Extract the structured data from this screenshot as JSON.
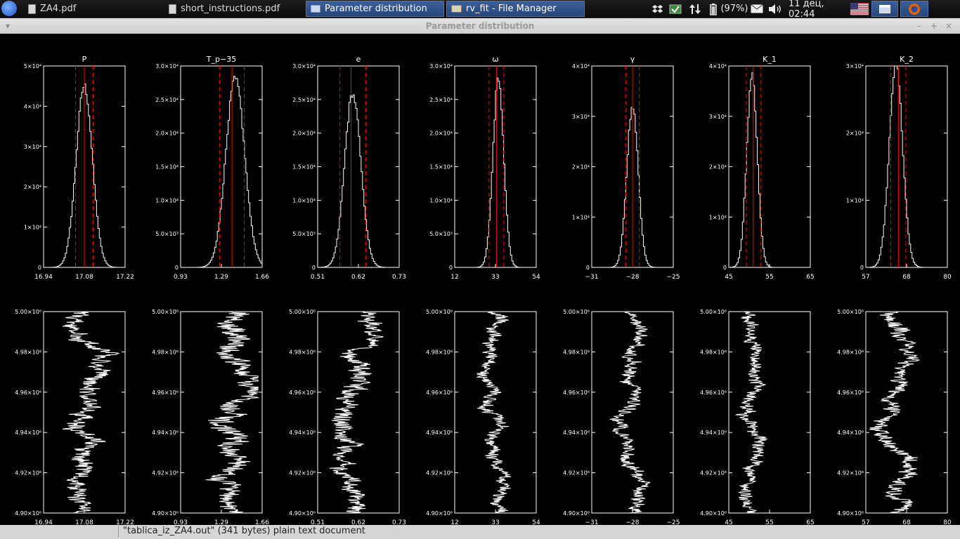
{
  "taskbar": {
    "items": [
      {
        "label": "ZA4.pdf",
        "icon": "document-icon"
      },
      {
        "label": "short_instructions.pdf",
        "icon": "document-icon"
      },
      {
        "label": "Parameter distribution",
        "icon": "window-icon"
      },
      {
        "label": "rv_fit - File Manager",
        "icon": "folder-icon"
      }
    ],
    "battery": "(97%)",
    "clock": "11 дец, 02:44"
  },
  "window": {
    "title": "Parameter distribution",
    "buttons": {
      "menu": "▾",
      "minimize": "–",
      "maximize": "+",
      "close": "×"
    }
  },
  "statusbar": {
    "text": "\"tablica_iz_ZA4.out\" (341 bytes) plain text document"
  },
  "chart_data": [
    {
      "type": "histogram",
      "title": "P",
      "xticks": [
        "16.94",
        "17.08",
        "17.22"
      ],
      "xlim": [
        16.94,
        17.22
      ],
      "yticks": [
        "0",
        "1×10⁴",
        "2×10⁴",
        "3×10⁴",
        "4×10⁴",
        "5×10⁴"
      ],
      "ylim": [
        0,
        50000
      ],
      "mean": 17.08,
      "lower": 17.05,
      "upper": 17.11,
      "peak_x": 17.08,
      "peak_y": 45000,
      "sigma": 0.028,
      "line_color": "#ff0000"
    },
    {
      "type": "histogram",
      "title": "T_p−35",
      "xticks": [
        "0.93",
        "1.29",
        "1.66"
      ],
      "xlim": [
        0.93,
        1.66
      ],
      "yticks": [
        "0",
        "5.0×10³",
        "1.0×10⁴",
        "1.5×10⁴",
        "2.0×10⁴",
        "2.5×10⁴",
        "3.0×10⁴"
      ],
      "ylim": [
        0,
        30000
      ],
      "mean": 1.39,
      "lower": 1.28,
      "upper": 1.5,
      "peak_x": 1.42,
      "peak_y": 28000,
      "sigma": 0.085,
      "line_color": "#ff0000"
    },
    {
      "type": "histogram",
      "title": "e",
      "xticks": [
        "0.51",
        "0.62",
        "0.73"
      ],
      "xlim": [
        0.51,
        0.73
      ],
      "yticks": [
        "0",
        "5.0×10³",
        "1.0×10⁴",
        "1.5×10⁴",
        "2.0×10⁴",
        "2.5×10⁴",
        "3.0×10⁴"
      ],
      "ylim": [
        0,
        30000
      ],
      "mean": 0.6,
      "lower": 0.57,
      "upper": 0.64,
      "peak_x": 0.605,
      "peak_y": 26000,
      "sigma": 0.022,
      "line_color": "#ff0000"
    },
    {
      "type": "histogram",
      "title": "ω",
      "xticks": [
        "12",
        "33",
        "54"
      ],
      "xlim": [
        12,
        54
      ],
      "yticks": [
        "0",
        "5.0×10³",
        "1.0×10⁴",
        "1.5×10⁴",
        "2.0×10⁴",
        "2.5×10⁴",
        "3.0×10⁴"
      ],
      "ylim": [
        0,
        30000
      ],
      "mean": 33.5,
      "lower": 29.7,
      "upper": 37.3,
      "peak_x": 34.5,
      "peak_y": 28000,
      "sigma": 2.8,
      "line_color": "#ff0000"
    },
    {
      "type": "histogram",
      "title": "γ",
      "xticks": [
        "−31",
        "−28",
        "−25"
      ],
      "xlim": [
        -31,
        -25
      ],
      "yticks": [
        "0",
        "1×10⁴",
        "2×10⁴",
        "3×10⁴",
        "4×10⁴"
      ],
      "ylim": [
        0,
        40000
      ],
      "mean": -28,
      "lower": -28.5,
      "upper": -27.5,
      "peak_x": -28,
      "peak_y": 32000,
      "sigma": 0.42,
      "line_color": "#ff0000"
    },
    {
      "type": "histogram",
      "title": "K_1",
      "xticks": [
        "45",
        "55",
        "65"
      ],
      "xlim": [
        45,
        65
      ],
      "yticks": [
        "0",
        "1×10⁴",
        "2×10⁴",
        "3×10⁴",
        "4×10⁴"
      ],
      "ylim": [
        0,
        40000
      ],
      "mean": 51,
      "lower": 49.3,
      "upper": 52.9,
      "peak_x": 50.7,
      "peak_y": 38000,
      "sigma": 1.3,
      "line_color": "#ff0000"
    },
    {
      "type": "histogram",
      "title": "K_2",
      "xticks": [
        "57",
        "68",
        "80"
      ],
      "xlim": [
        57,
        80
      ],
      "yticks": [
        "0",
        "1×10⁴",
        "2×10⁴",
        "3×10⁴"
      ],
      "ylim": [
        0,
        30000
      ],
      "mean": 66.2,
      "lower": 64,
      "upper": 68.3,
      "peak_x": 65.5,
      "peak_y": 30000,
      "sigma": 1.9,
      "line_color": "#ff0000"
    }
  ],
  "trace_yticks": [
    "4.90×10⁶",
    "4.92×10⁶",
    "4.94×10⁶",
    "4.96×10⁶",
    "4.98×10⁶",
    "5.00×10⁶"
  ],
  "trace_ylim": [
    4900000,
    5000000
  ]
}
